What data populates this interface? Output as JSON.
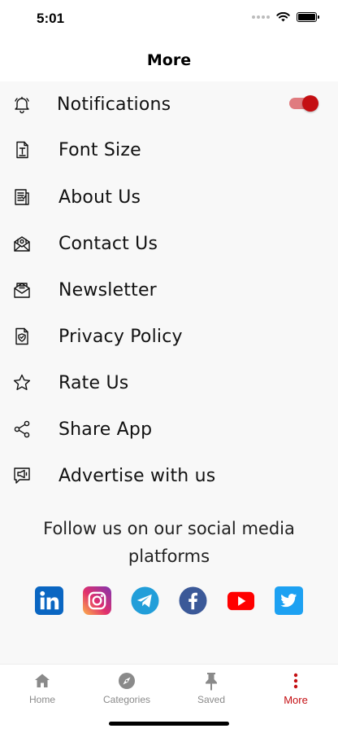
{
  "status_bar": {
    "time": "5:01"
  },
  "header": {
    "title": "More"
  },
  "menu": {
    "items": [
      {
        "label": "Notifications",
        "icon": "bell-icon"
      },
      {
        "label": "Font Size",
        "icon": "font-size-icon"
      },
      {
        "label": "About Us",
        "icon": "document-icon"
      },
      {
        "label": "Contact Us",
        "icon": "contact-envelope-icon"
      },
      {
        "label": "Newsletter",
        "icon": "newsletter-icon"
      },
      {
        "label": "Privacy Policy",
        "icon": "privacy-shield-icon"
      },
      {
        "label": "Rate Us",
        "icon": "star-icon"
      },
      {
        "label": "Share App",
        "icon": "share-icon"
      },
      {
        "label": "Advertise with us",
        "icon": "megaphone-icon"
      }
    ],
    "notifications_enabled": true
  },
  "social": {
    "follow_text": "Follow us on our social media platforms",
    "networks": [
      "linkedin",
      "instagram",
      "telegram",
      "facebook",
      "youtube",
      "twitter"
    ]
  },
  "tab_bar": {
    "tabs": [
      {
        "label": "Home",
        "icon": "home-icon"
      },
      {
        "label": "Categories",
        "icon": "compass-icon"
      },
      {
        "label": "Saved",
        "icon": "pin-icon"
      },
      {
        "label": "More",
        "icon": "more-vertical-icon"
      }
    ],
    "active": "More"
  },
  "colors": {
    "accent": "#c40e12",
    "toggle_track": "#e07b7f",
    "content_bg": "#f8f8f8",
    "tab_inactive": "#8a8a8a"
  }
}
